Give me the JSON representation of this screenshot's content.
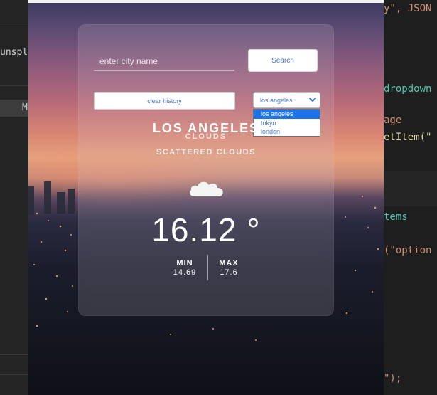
{
  "editor_left": {
    "text": "unspla",
    "tab_label": "M"
  },
  "editor_right": {
    "lines": [
      {
        "text": "y\", JSON",
        "color": "#ce9178"
      },
      {
        "text": "dropdown",
        "color": "#4ec9b0"
      },
      {
        "text": "age",
        "color": "#ce9178"
      },
      {
        "text": "etItem(\"",
        "color": "#dcdcaa"
      },
      {
        "text": "tems",
        "color": "#4ec9b0"
      },
      {
        "text": "(\"option",
        "color": "#ce9178"
      },
      {
        "text": "\");",
        "color": "#ce9178"
      }
    ]
  },
  "app": {
    "search": {
      "placeholder": "enter city name",
      "button_label": "Search"
    },
    "clear_history_label": "clear history",
    "city_select": {
      "selected": "los angeles",
      "options": [
        "los angeles",
        "tokyo",
        "london"
      ]
    },
    "weather": {
      "city": "LOS ANGELES",
      "main": "CLOUDS",
      "description": "SCATTERED CLOUDS",
      "icon": "cloud-icon",
      "temperature": "16.12 °",
      "min_label": "MIN",
      "min_value": "14.69",
      "max_label": "MAX",
      "max_value": "17.6"
    }
  },
  "colors": {
    "accent_blue": "#4a78c8",
    "selected_option": "#1e73e8"
  }
}
